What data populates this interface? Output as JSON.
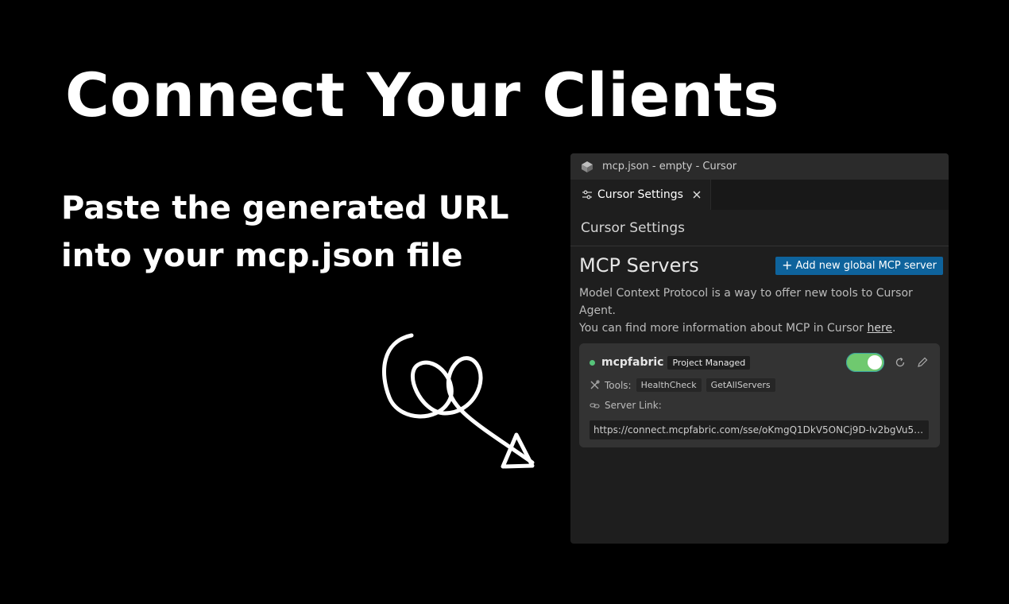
{
  "slide": {
    "headline": "Connect Your Clients",
    "subtitle_line1": "Paste the generated URL",
    "subtitle_line2": "into your mcp.json file"
  },
  "window": {
    "title": "mcp.json - empty - Cursor",
    "tab_label": "Cursor Settings",
    "settings_header": "Cursor Settings",
    "section_title": "MCP Servers",
    "add_button_label": "Add new global MCP server",
    "description_line1": "Model Context Protocol is a way to offer new tools to Cursor Agent.",
    "description_line2_prefix": "You can find more information about MCP in Cursor ",
    "description_link": "here",
    "description_suffix": "."
  },
  "server": {
    "name": "mcpfabric",
    "badge": "Project Managed",
    "enabled": true,
    "tools_label": "Tools:",
    "tools": [
      "HealthCheck",
      "GetAllServers"
    ],
    "server_link_label": "Server Link:",
    "url": "https://connect.mcpfabric.com/sse/oKmgQ1DkV5ONCj9D-Iv2bgVu5VJYzlVf..."
  },
  "colors": {
    "background": "#000000",
    "accent_button": "#0e639c",
    "toggle_on": "#6fc96f",
    "status_dot": "#56c47a"
  },
  "icons": {
    "app": "cursor-logo-icon",
    "tab": "settings-sliders-icon",
    "close": "close-icon",
    "refresh": "refresh-icon",
    "edit": "pencil-icon",
    "tools": "tools-icon",
    "link": "link-icon",
    "arrow": "hand-drawn-arrow-icon"
  }
}
